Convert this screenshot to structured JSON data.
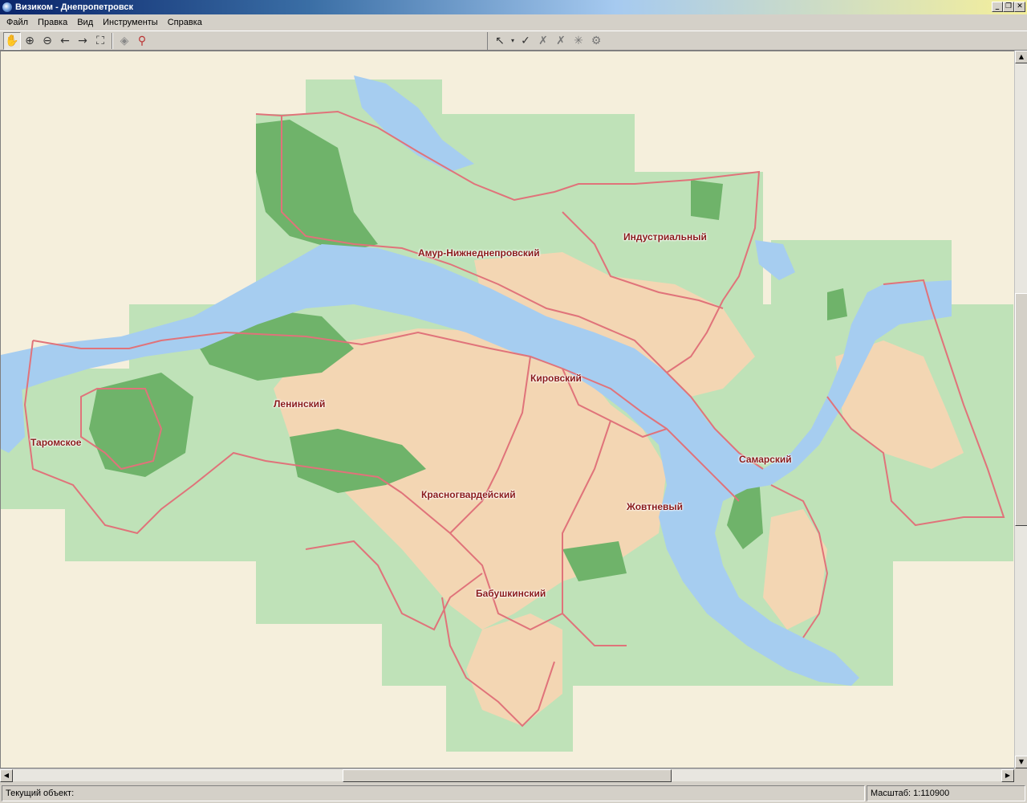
{
  "window": {
    "title": "Визиком - Днепропетровск",
    "controls": [
      "_",
      "❐",
      "✕"
    ]
  },
  "menu": {
    "items": [
      "Файл",
      "Правка",
      "Вид",
      "Инструменты",
      "Справка"
    ]
  },
  "toolbar": {
    "left_tools": [
      "hand-icon",
      "zoom-in-icon",
      "zoom-out-icon",
      "arrow-left-icon",
      "arrow-right-icon",
      "zoom-extent-icon",
      "layers-icon",
      "search-object-icon"
    ],
    "right_tools": [
      "select-arrow-icon",
      "dropdown-icon",
      "select-list-icon",
      "deselect-icon",
      "deselect-list-icon",
      "burst-icon",
      "settings-icon"
    ]
  },
  "map": {
    "districts": [
      "Амур-Нижнеднепровский",
      "Индустриальный",
      "Кировский",
      "Ленинский",
      "Таромское",
      "Самарский",
      "Красногвардейский",
      "Жовтневый",
      "Бабушкинский"
    ],
    "colors": {
      "background": "#f5efdc",
      "land": "#bfe2b8",
      "forest": "#6fb36a",
      "urban": "#f3d6b3",
      "water": "#a6cdf0",
      "border": "#e0737a"
    }
  },
  "status": {
    "current_object_label": "Текущий объект:",
    "scale_label": "Масштаб: 1:110900"
  }
}
